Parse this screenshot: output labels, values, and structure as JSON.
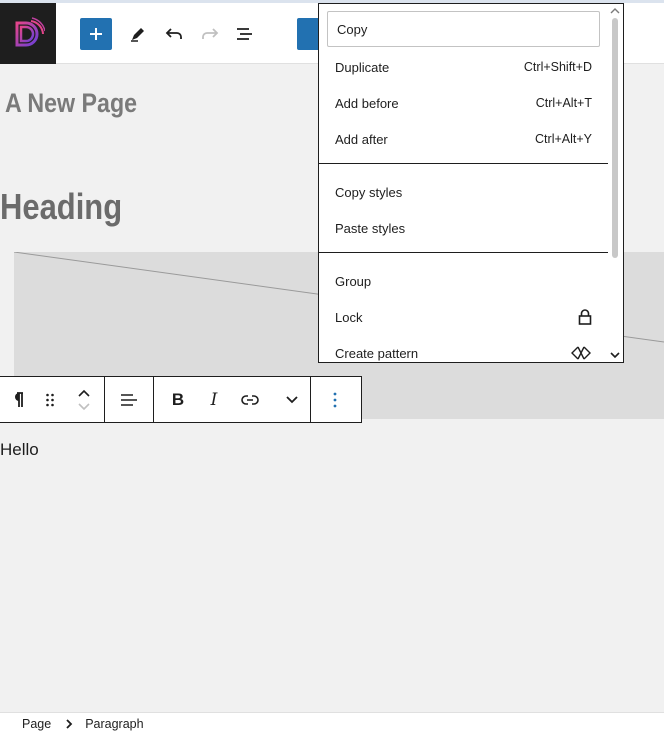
{
  "header": {
    "logo_letter": "D"
  },
  "canvas": {
    "page_title": "A New Page",
    "heading": "Heading",
    "paragraph": "Hello"
  },
  "block_toolbar": {
    "bold_label": "B",
    "italic_label": "I"
  },
  "menu": {
    "copy": "Copy",
    "group1": [
      {
        "label": "Duplicate",
        "shortcut": "Ctrl+Shift+D"
      },
      {
        "label": "Add before",
        "shortcut": "Ctrl+Alt+T"
      },
      {
        "label": "Add after",
        "shortcut": "Ctrl+Alt+Y"
      }
    ],
    "group2": [
      {
        "label": "Copy styles"
      },
      {
        "label": "Paste styles"
      }
    ],
    "group3": [
      {
        "label": "Group"
      },
      {
        "label": "Lock"
      },
      {
        "label": "Create pattern"
      }
    ]
  },
  "footer": {
    "breadcrumb": [
      "Page",
      "Paragraph"
    ]
  },
  "colors": {
    "accent": "#2271b1",
    "logo_bg": "#1e1e1e",
    "canvas_bg": "#f1f1f1"
  }
}
